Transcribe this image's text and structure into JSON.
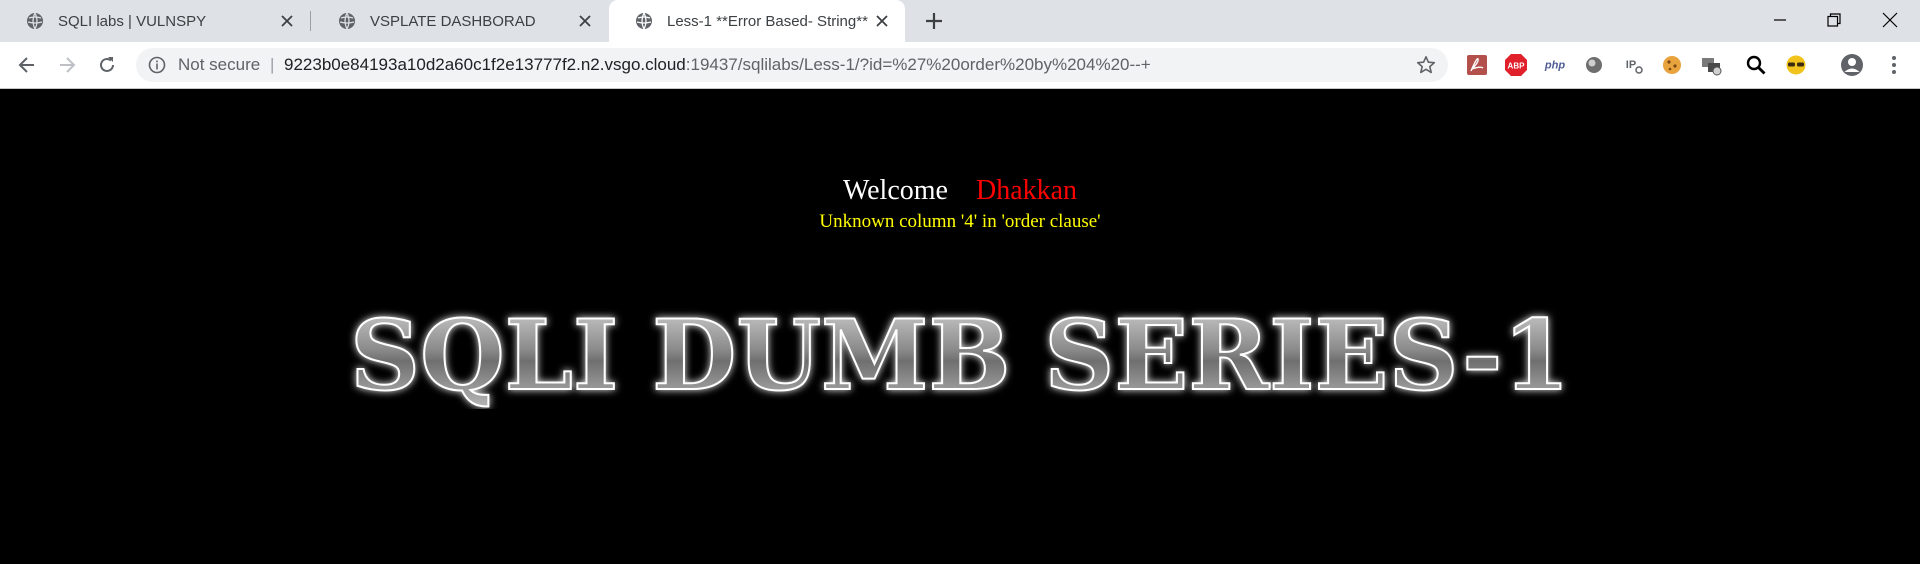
{
  "browser": {
    "tabs": [
      {
        "title": "SQLI labs | VULNSPY",
        "active": false
      },
      {
        "title": "VSPLATE DASHBORAD",
        "active": false
      },
      {
        "title": "Less-1 **Error Based- String**",
        "active": true
      }
    ],
    "address_bar": {
      "security_label": "Not secure",
      "separator": "|",
      "url_host": "9223b0e84193a10d2a60c1f2e13777f2.n2.vsgo.cloud",
      "url_path": ":19437/sqlilabs/Less-1/?id=%27%20order%20by%204%20--+"
    },
    "extensions": [
      "pdf-icon",
      "adblock-icon",
      "php-icon",
      "circle-icon",
      "ip-icon",
      "cookie-icon",
      "network-icon",
      "search-icon",
      "glasses-icon",
      "account-icon"
    ]
  },
  "page": {
    "welcome_label": "Welcome",
    "user_name": "Dhakkan",
    "error_message": "Unknown column '4' in 'order clause'",
    "banner_text": "SQLI DUMB SERIES-1"
  },
  "colors": {
    "welcome": "#ffffff",
    "user_name": "#ff0000",
    "error_message": "#ffff00",
    "background": "#000000"
  }
}
